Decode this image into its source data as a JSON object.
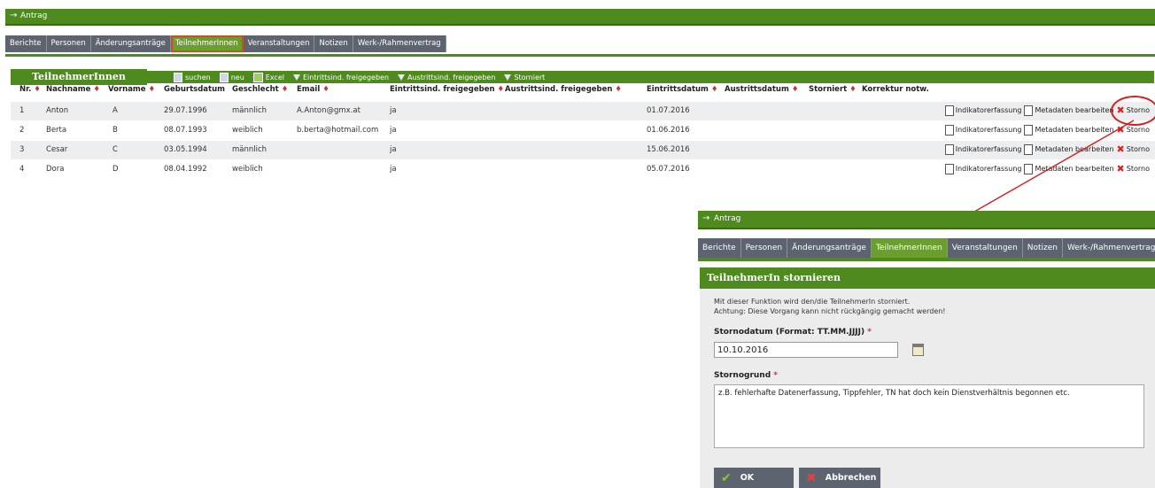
{
  "header": {
    "arrow": "→",
    "title": "Antrag"
  },
  "tabs": [
    "Berichte",
    "Personen",
    "Änderungsanträge",
    "TeilnehmerInnen",
    "Veranstaltungen",
    "Notizen",
    "Werk-/Rahmenvertrag"
  ],
  "list": {
    "title": "TeilnehmerInnen",
    "toolbar": [
      "suchen",
      "neu",
      "Excel",
      "Eintrittsind. freigegeben",
      "Austrittsind. freigegeben",
      "Storniert"
    ],
    "columns": [
      "Nr.",
      "Nachname",
      "Vorname",
      "Geburtsdatum",
      "Geschlecht",
      "Email",
      "Eintrittsind. freigegeben",
      "Austrittsind. freigegeben",
      "Eintrittsdatum",
      "Austrittsdatum",
      "Storniert",
      "Korrektur notw."
    ],
    "rows": [
      {
        "nr": "1",
        "nachname": "Anton",
        "vorname": "A",
        "geburtsdatum": "29.07.1996",
        "geschlecht": "männlich",
        "email": "A.Anton@gmx.at",
        "eintritt_frei": "ja",
        "eintrittsdatum": "01.07.2016"
      },
      {
        "nr": "2",
        "nachname": "Berta",
        "vorname": "B",
        "geburtsdatum": "08.07.1993",
        "geschlecht": "weiblich",
        "email": "b.berta@hotmail.com",
        "eintritt_frei": "ja",
        "eintrittsdatum": "01.06.2016"
      },
      {
        "nr": "3",
        "nachname": "Cesar",
        "vorname": "C",
        "geburtsdatum": "03.05.1994",
        "geschlecht": "männlich",
        "email": "",
        "eintritt_frei": "ja",
        "eintrittsdatum": "15.06.2016"
      },
      {
        "nr": "4",
        "nachname": "Dora",
        "vorname": "D",
        "geburtsdatum": "08.04.1992",
        "geschlecht": "weiblich",
        "email": "",
        "eintritt_frei": "ja",
        "eintrittsdatum": "05.07.2016"
      }
    ],
    "actions": {
      "indikator": "Indikatorerfassung",
      "metadaten": "Metadaten bearbeiten",
      "storno": "Storno"
    }
  },
  "dialog": {
    "title": "Antrag",
    "heading": "TeilnehmerIn stornieren",
    "info1": "Mit dieser Funktion wird den/die TeilnehmerIn storniert.",
    "info2": "Achtung: Diese Vorgang kann nicht rückgängig gemacht werden!",
    "date_label": "Stornodatum (Format: TT.MM.JJJJ)",
    "date_value": "10.10.2016",
    "reason_label": "Stornogrund",
    "reason_value": "z.B. fehlerhafte Datenerfassung, Tippfehler, TN hat doch kein Dienstverhältnis begonnen etc.",
    "required_mark": "*",
    "ok": "OK",
    "cancel": "Abbrechen"
  },
  "colors": {
    "green": "#4e8a1e",
    "tab_gray": "#5d6470",
    "annotation_red": "#d31f1f"
  }
}
